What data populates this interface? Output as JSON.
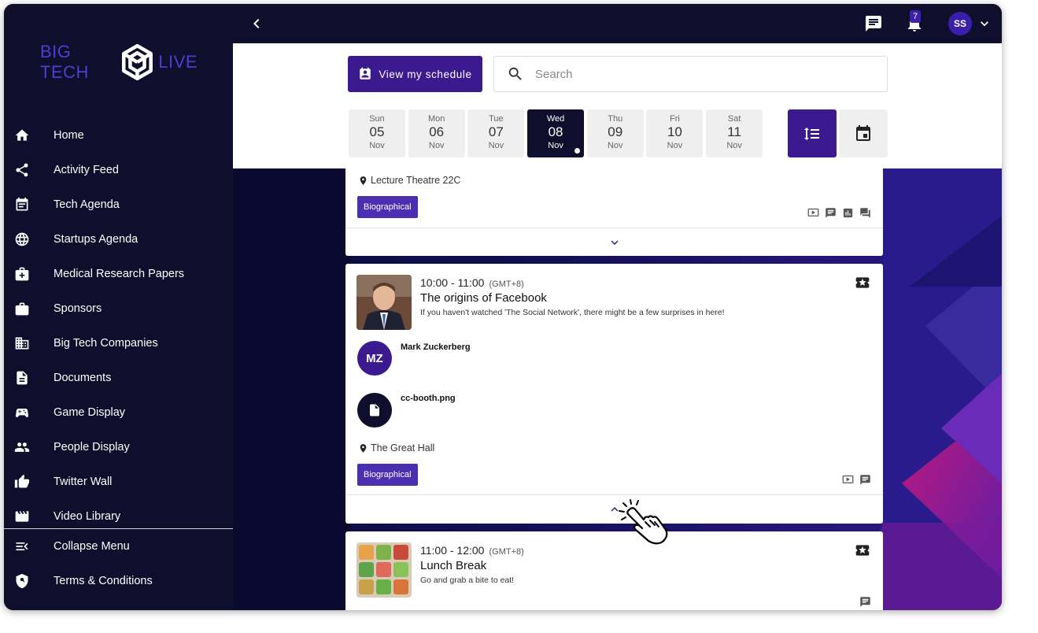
{
  "logo": {
    "left": "BIG TECH",
    "right": "LIVE"
  },
  "nav": {
    "items": [
      {
        "label": "Home",
        "icon": "home-icon"
      },
      {
        "label": "Activity Feed",
        "icon": "share-icon"
      },
      {
        "label": "Tech Agenda",
        "icon": "calendar-icon"
      },
      {
        "label": "Startups Agenda",
        "icon": "globe-icon"
      },
      {
        "label": "Medical Research Papers",
        "icon": "medical-bag-icon"
      },
      {
        "label": "Sponsors",
        "icon": "briefcase-icon"
      },
      {
        "label": "Big Tech Companies",
        "icon": "building-icon"
      },
      {
        "label": "Documents",
        "icon": "document-icon"
      },
      {
        "label": "Game Display",
        "icon": "gamepad-icon"
      },
      {
        "label": "People Display",
        "icon": "people-icon"
      },
      {
        "label": "Twitter Wall",
        "icon": "thumbs-up-icon"
      },
      {
        "label": "Video Library",
        "icon": "film-icon"
      }
    ],
    "bottom": [
      {
        "label": "Collapse Menu",
        "icon": "collapse-menu-icon"
      },
      {
        "label": "Terms & Conditions",
        "icon": "shield-icon"
      }
    ]
  },
  "topbar": {
    "notification_count": "7",
    "user_initials": "SS"
  },
  "toolbar": {
    "schedule_label": "View my schedule",
    "search_placeholder": "Search"
  },
  "days": [
    {
      "name": "Sun",
      "date": "05",
      "month": "Nov"
    },
    {
      "name": "Mon",
      "date": "06",
      "month": "Nov"
    },
    {
      "name": "Tue",
      "date": "07",
      "month": "Nov"
    },
    {
      "name": "Wed",
      "date": "08",
      "month": "Nov",
      "active": true
    },
    {
      "name": "Thu",
      "date": "09",
      "month": "Nov"
    },
    {
      "name": "Fri",
      "date": "10",
      "month": "Nov"
    },
    {
      "name": "Sat",
      "date": "11",
      "month": "Nov"
    }
  ],
  "sessions": {
    "first": {
      "location": "Lecture Theatre 22C",
      "tag": "Biographical"
    },
    "second": {
      "time": "10:00 - 11:00",
      "tz": "(GMT+8)",
      "title": "The origins of Facebook",
      "description": "If you haven't watched 'The Social Network', there might be a few surprises in here!",
      "speaker_initials": "MZ",
      "speaker_name": "Mark Zuckerberg",
      "file_name": "cc-booth.png",
      "location": "The Great Hall",
      "tag": "Biographical"
    },
    "third": {
      "time": "11:00 - 12:00",
      "tz": "(GMT+8)",
      "title": "Lunch Break",
      "description": "Go and grab a bite to eat!"
    }
  },
  "colors": {
    "sidebar_bg": "#0f0e2c",
    "accent": "#3b1a8f",
    "tag": "#4b2fb0"
  }
}
